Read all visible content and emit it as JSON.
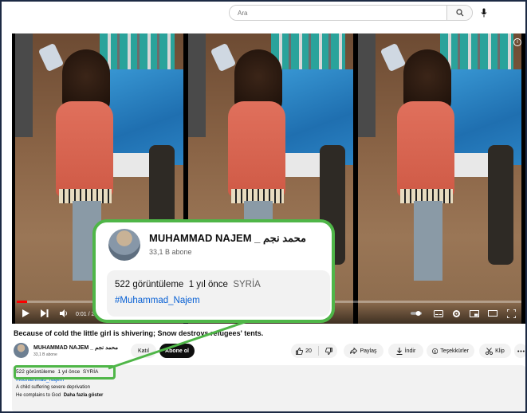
{
  "search": {
    "placeholder": "Ara"
  },
  "player": {
    "time": "0:01 / 2:1",
    "progress_fraction": 0.02
  },
  "video": {
    "title": "Because of cold the little girl is shivering; Snow destroys refugees' tents."
  },
  "channel": {
    "name": "MUHAMMAD NAJEM _ محمد نجم",
    "subscribers": "33,1 B abone",
    "join_label": "Katıl",
    "subscribe_label": "Abone ol"
  },
  "actions": {
    "likes": "20",
    "share": "Paylaş",
    "download": "İndir",
    "thanks": "Teşekkürler",
    "clip": "Klip"
  },
  "description": {
    "views": "522 görüntüleme",
    "age": "1 yıl önce",
    "location": "SYRİA",
    "hashtag": "#Muhammad_Najem",
    "line1": "A child suffering severe deprivation",
    "line2": "He complains to God",
    "more": "Daha fazla göster"
  },
  "zoom": {
    "channel_name": "MUHAMMAD NAJEM _ محمد نجم",
    "subscribers": "33,1 B abone",
    "views": "522 görüntüleme",
    "age": "1 yıl önce",
    "location": "SYRİA",
    "hashtag": "#Muhammad_Najem"
  },
  "colors": {
    "highlight": "#4fb648",
    "link": "#065fd4",
    "progress": "#ff0000"
  }
}
